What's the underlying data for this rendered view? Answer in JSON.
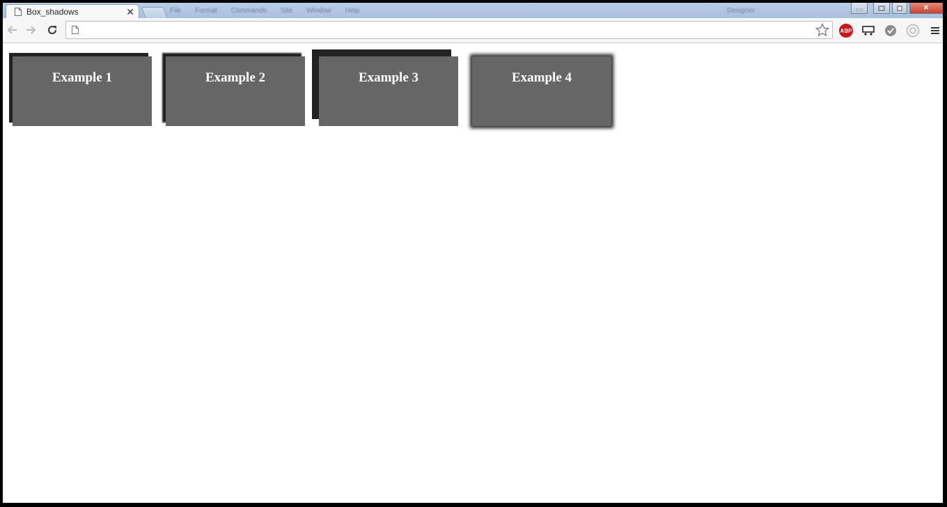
{
  "browser": {
    "tab": {
      "title": "Box_shadows",
      "close_label": "✕"
    },
    "background_menu": [
      "File",
      "Format",
      "Commands",
      "Site",
      "Window",
      "Help"
    ],
    "background_user": "Designer",
    "window_controls": {
      "close_label": "✕"
    },
    "address_bar": {
      "value": "",
      "placeholder": ""
    },
    "extensions": [
      "adblock-plus-icon",
      "cast-icon",
      "check-icon",
      "circle-icon"
    ],
    "extension_labels": {
      "abp": "ABP"
    },
    "colors": {
      "abp_red": "#c8171b",
      "tabstrip": "#a9c0dc",
      "close_red": "#c7432f"
    }
  },
  "page": {
    "examples": [
      {
        "label": "Example 1"
      },
      {
        "label": "Example 2"
      },
      {
        "label": "Example 3"
      },
      {
        "label": "Example 4"
      }
    ],
    "colors": {
      "box_fill": "#666666",
      "shadow": "#222222",
      "text": "#ffffff"
    }
  }
}
